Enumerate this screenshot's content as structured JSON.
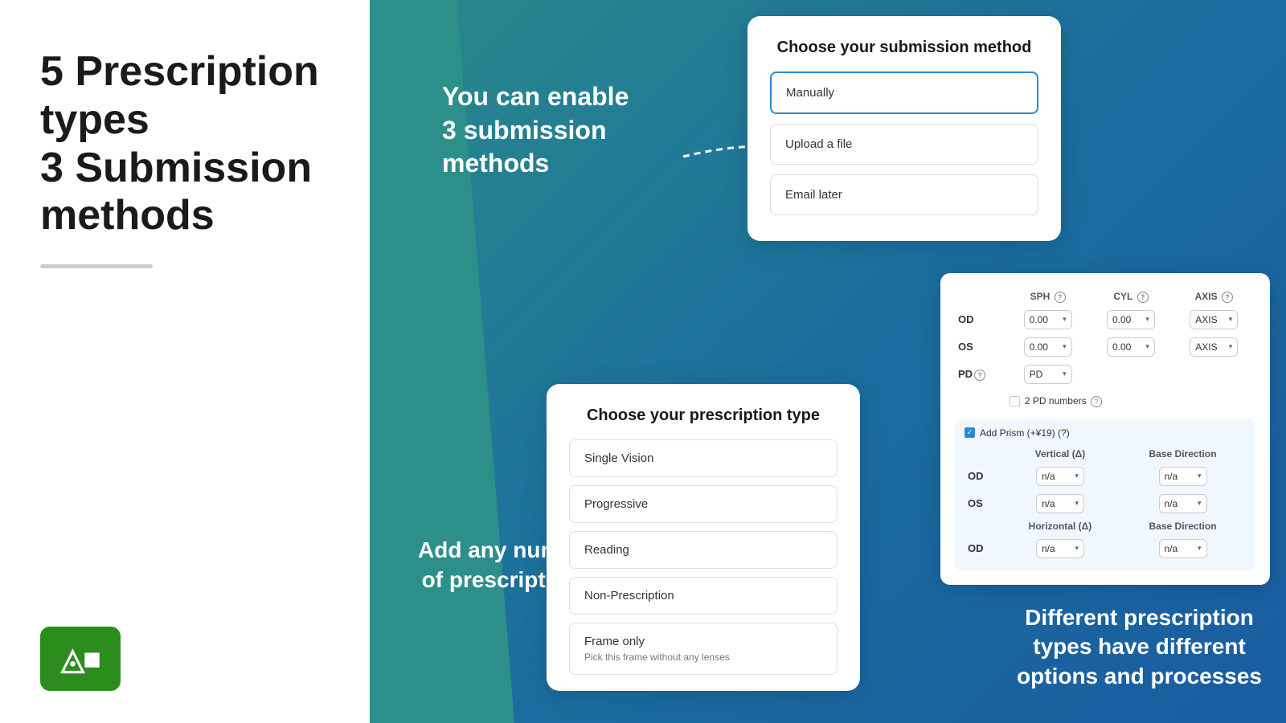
{
  "left": {
    "title_line1": "5 Prescription types",
    "title_line2": "3 Submission",
    "title_line3": "methods"
  },
  "middle": {
    "enable_text_line1": "You can enable",
    "enable_text_line2": "3 submission",
    "enable_text_line3": "methods",
    "add_text_line1": "Add any number",
    "add_text_line2": "of prescriptions"
  },
  "submission_card": {
    "title": "Choose your submission method",
    "options": [
      {
        "label": "Manually",
        "selected": true
      },
      {
        "label": "Upload a file",
        "selected": false
      },
      {
        "label": "Email later",
        "selected": false
      }
    ]
  },
  "prescription_card": {
    "title": "Choose your prescription type",
    "options": [
      {
        "label": "Single Vision",
        "sub": ""
      },
      {
        "label": "Progressive",
        "sub": ""
      },
      {
        "label": "Reading",
        "sub": ""
      },
      {
        "label": "Non-Prescription",
        "sub": ""
      },
      {
        "label": "Frame only",
        "sub": "Pick this frame without any lenses"
      }
    ]
  },
  "rx_form": {
    "headers": [
      "SPH (?)",
      "CYL (?)",
      "AXIS (?)"
    ],
    "rows": [
      {
        "eye": "OD",
        "sph": "0.00",
        "cyl": "0.00",
        "axis": "AXIS"
      },
      {
        "eye": "OS",
        "sph": "0.00",
        "cyl": "0.00",
        "axis": "AXIS"
      }
    ],
    "pd_label": "PD",
    "pd_value": "PD",
    "two_pd_label": "2 PD numbers (?)",
    "add_prism_label": "Add Prism (+¥19) (?)",
    "prism_cols1": [
      "Vertical (Δ)",
      "Base Direction"
    ],
    "prism_rows": [
      {
        "eye": "OD",
        "v": "n/a",
        "bd": "n/a"
      },
      {
        "eye": "OS",
        "v": "n/a",
        "bd": "n/a"
      }
    ],
    "prism_cols2": [
      "Horizontal (Δ)",
      "Base Direction"
    ],
    "prism_h_row": {
      "eye": "OD",
      "h": "n/a",
      "bd": "n/a"
    }
  },
  "bottom_right": {
    "text_line1": "Different prescription",
    "text_line2": "types have different",
    "text_line3": "options and processes"
  }
}
